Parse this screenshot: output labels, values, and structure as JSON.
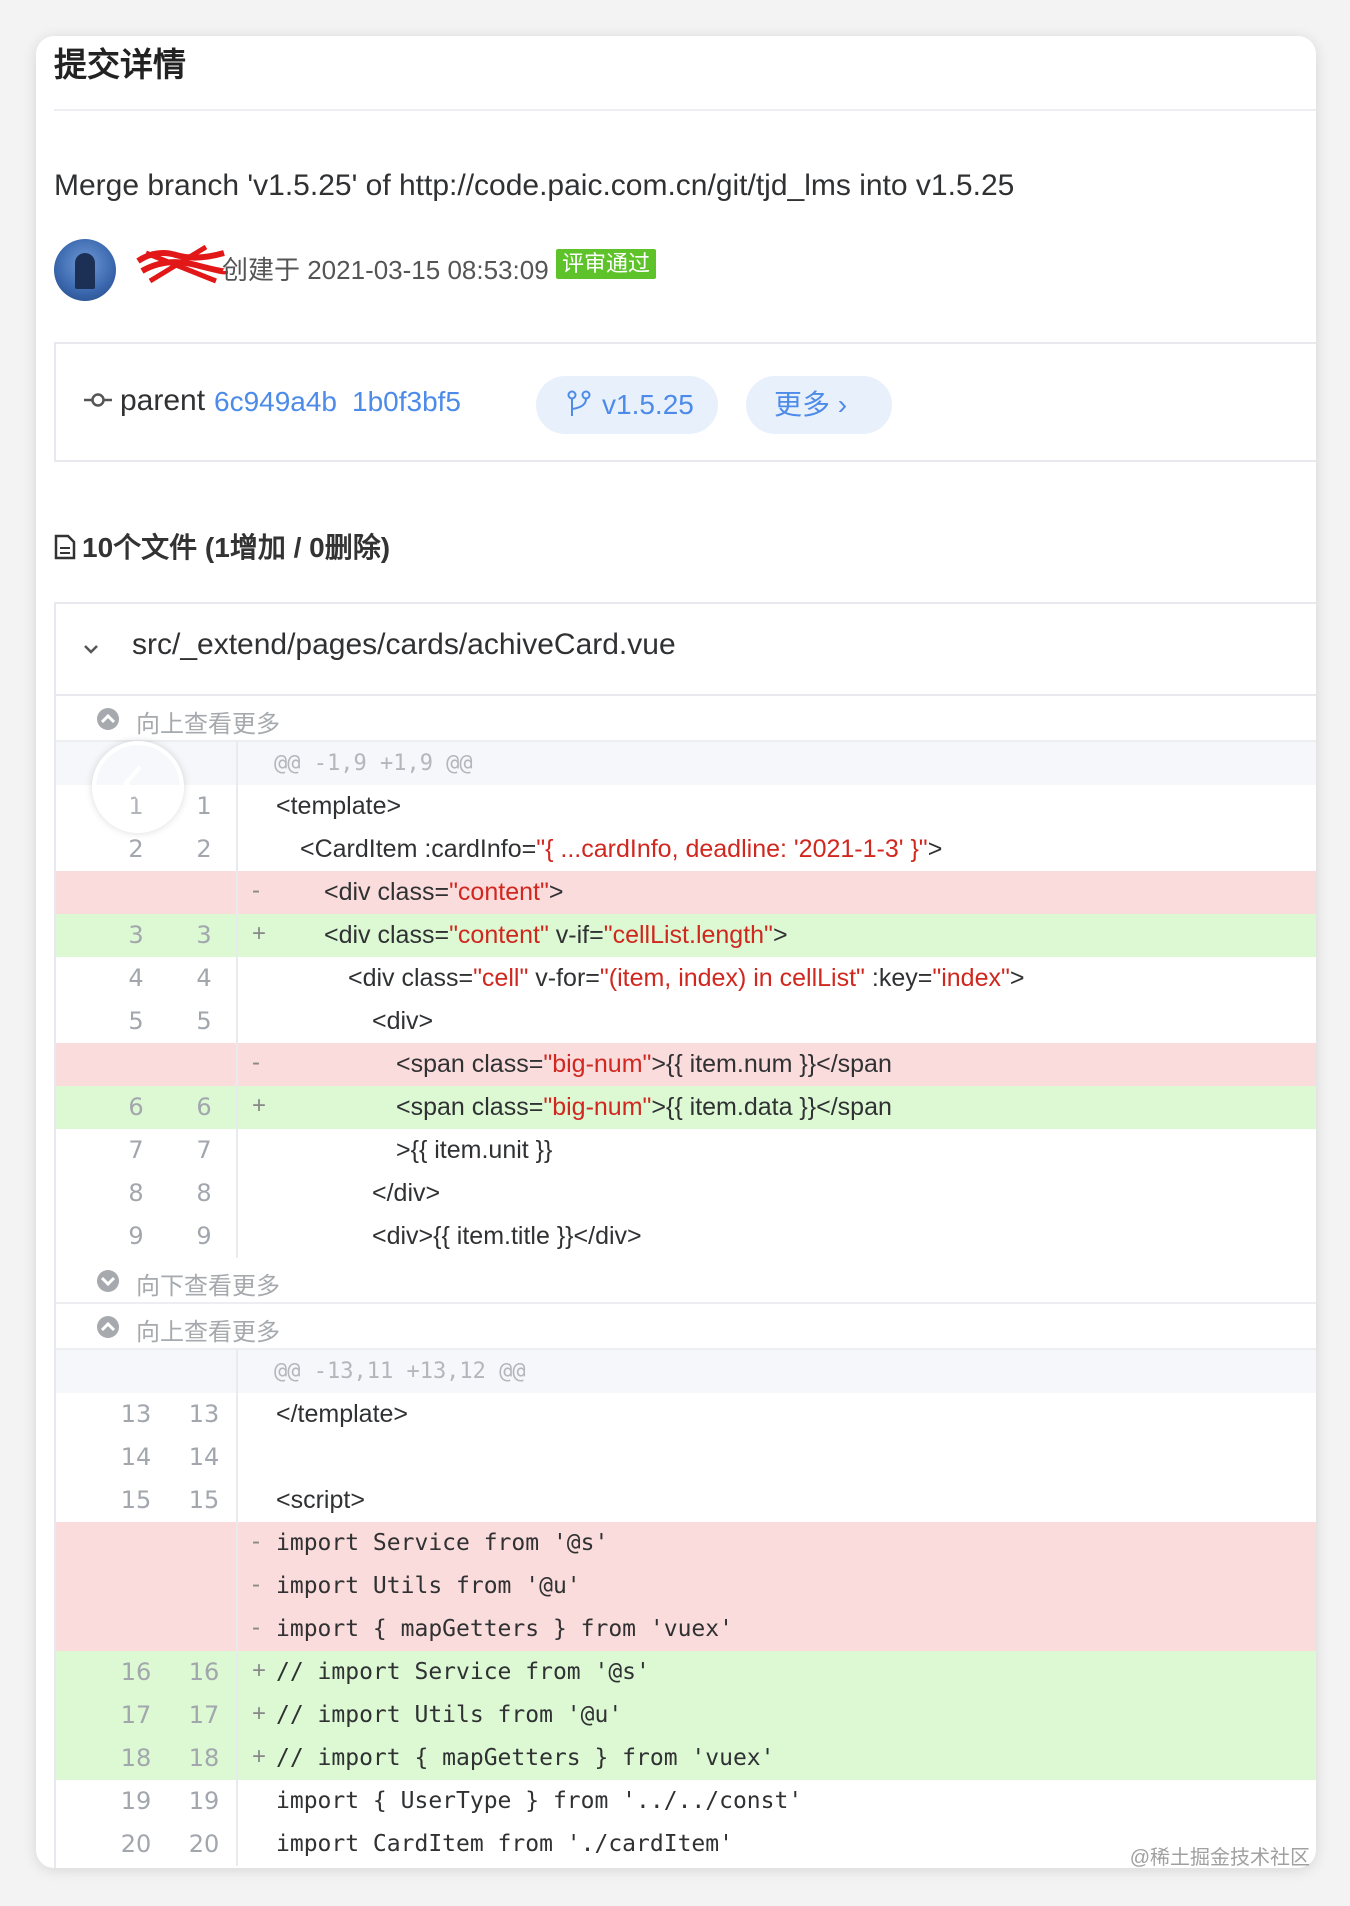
{
  "page": {
    "title": "提交详情",
    "commit_message": "Merge branch 'v1.5.25' of http://code.paic.com.cn/git/tjd_lms into v1.5.25",
    "created_text": "创建于 2021-03-15 08:53:09",
    "status_badge": "评审通过",
    "status_color": "#5ec32a",
    "accent_color": "#4d8be8"
  },
  "parents": {
    "label": "parent",
    "hashes": [
      "6c949a4b",
      "1b0f3bf5"
    ],
    "branch": "v1.5.25",
    "more": "更多 ›"
  },
  "files_heading": "10个文件 (1增加 / 0删除)",
  "file": {
    "path": "src/_extend/pages/cards/achiveCard.vue",
    "expand_up": "向上查看更多",
    "expand_down": "向下查看更多"
  },
  "hunks": [
    {
      "header": "@@ -1,9 +1,9 @@",
      "lines": [
        {
          "type": "ctx",
          "old": "1",
          "new": "1",
          "sign": "",
          "indent": 0,
          "code": "<template>"
        },
        {
          "type": "ctx",
          "old": "2",
          "new": "2",
          "sign": "",
          "indent": 1,
          "code": "<CardItem :cardInfo=\"{ ...cardInfo, deadline: '2021-1-3' }\">"
        },
        {
          "type": "del",
          "old": "",
          "new": "",
          "sign": "-",
          "indent": 2,
          "code": "<div class=\"content\">"
        },
        {
          "type": "add",
          "old": "3",
          "new": "3",
          "sign": "+",
          "indent": 2,
          "code": "<div class=\"content\" v-if=\"cellList.length\">"
        },
        {
          "type": "ctx",
          "old": "4",
          "new": "4",
          "sign": "",
          "indent": 3,
          "code": "<div class=\"cell\" v-for=\"(item, index) in cellList\" :key=\"index\">"
        },
        {
          "type": "ctx",
          "old": "5",
          "new": "5",
          "sign": "",
          "indent": 4,
          "code": "<div>"
        },
        {
          "type": "del",
          "old": "",
          "new": "",
          "sign": "-",
          "indent": 5,
          "code": "<span class=\"big-num\">{{ item.num }}</span"
        },
        {
          "type": "add",
          "old": "6",
          "new": "6",
          "sign": "+",
          "indent": 5,
          "code": "<span class=\"big-num\">{{ item.data }}</span"
        },
        {
          "type": "ctx",
          "old": "7",
          "new": "7",
          "sign": "",
          "indent": 5,
          "code": ">{{ item.unit }}"
        },
        {
          "type": "ctx",
          "old": "8",
          "new": "8",
          "sign": "",
          "indent": 4,
          "code": "</div>"
        },
        {
          "type": "ctx",
          "old": "9",
          "new": "9",
          "sign": "",
          "indent": 4,
          "code": "<div>{{ item.title }}</div>"
        }
      ]
    },
    {
      "header": "@@ -13,11 +13,12 @@",
      "lines": [
        {
          "type": "ctx",
          "old": "13",
          "new": "13",
          "sign": "",
          "indent": 0,
          "code": "</template>"
        },
        {
          "type": "ctx",
          "old": "14",
          "new": "14",
          "sign": "",
          "indent": 0,
          "code": ""
        },
        {
          "type": "ctx",
          "old": "15",
          "new": "15",
          "sign": "",
          "indent": 0,
          "code": "<script>"
        },
        {
          "type": "del",
          "old": "",
          "new": "",
          "sign": "-",
          "indent": 0,
          "code": "import Service from '@s'",
          "mono": true
        },
        {
          "type": "del",
          "old": "",
          "new": "",
          "sign": "-",
          "indent": 0,
          "code": "import Utils from '@u'",
          "mono": true
        },
        {
          "type": "del",
          "old": "",
          "new": "",
          "sign": "-",
          "indent": 0,
          "code": "import { mapGetters } from 'vuex'",
          "mono": true
        },
        {
          "type": "add",
          "old": "16",
          "new": "16",
          "sign": "+",
          "indent": 0,
          "code": "// import Service from '@s'",
          "mono": true
        },
        {
          "type": "add",
          "old": "17",
          "new": "17",
          "sign": "+",
          "indent": 0,
          "code": "// import Utils from '@u'",
          "mono": true
        },
        {
          "type": "add",
          "old": "18",
          "new": "18",
          "sign": "+",
          "indent": 0,
          "code": "// import { mapGetters } from 'vuex'",
          "mono": true
        },
        {
          "type": "ctx",
          "old": "19",
          "new": "19",
          "sign": "",
          "indent": 0,
          "code": "import { UserType } from '../../const'",
          "mono": true
        },
        {
          "type": "ctx",
          "old": "20",
          "new": "20",
          "sign": "",
          "indent": 0,
          "code": "import CardItem from './cardItem'",
          "mono": true
        }
      ]
    }
  ],
  "watermark": "@稀土掘金技术社区"
}
